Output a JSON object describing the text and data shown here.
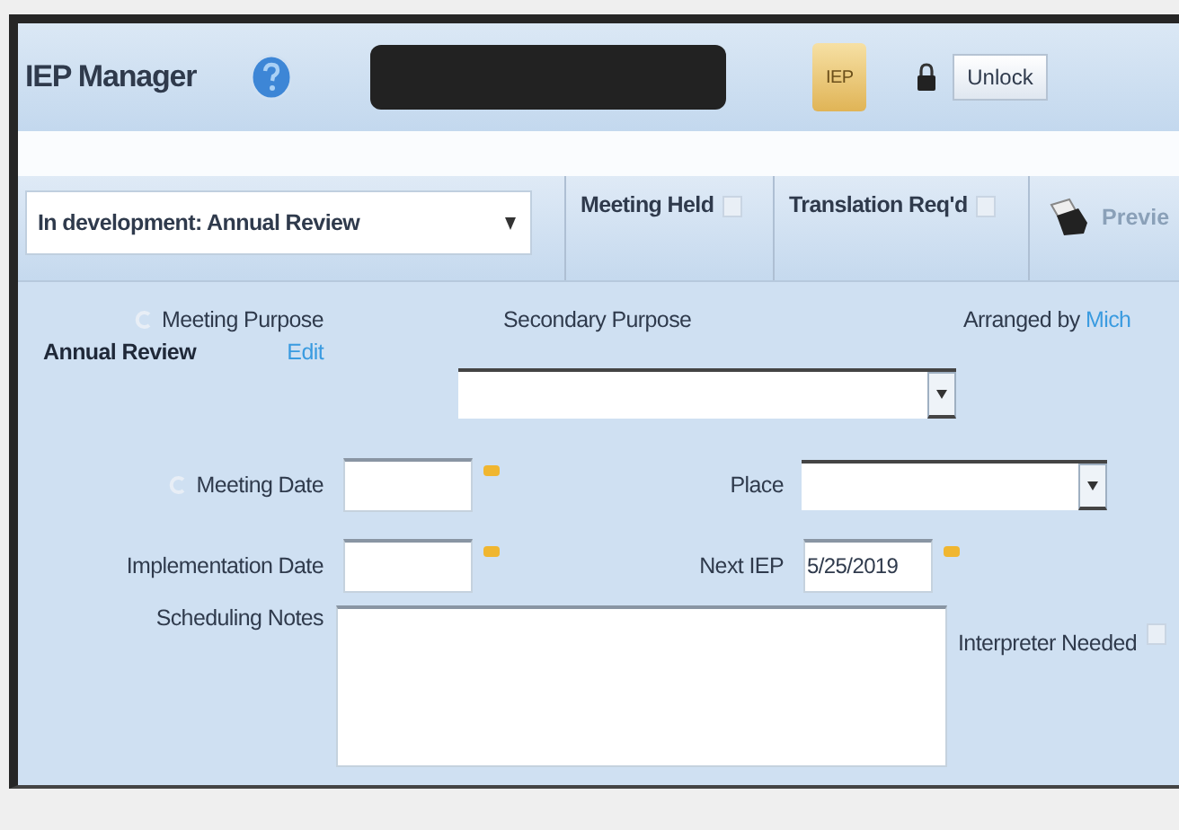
{
  "header": {
    "title": "IEP Manager",
    "folder_label": "IEP",
    "unlock_button": "Unlock"
  },
  "toolbar": {
    "status_select": "In development: Annual Review",
    "checkboxes": [
      {
        "label": "Meeting Held",
        "checked": false
      },
      {
        "label": "Translation Req'd",
        "checked": false
      }
    ],
    "preview_button": "Previe"
  },
  "form": {
    "meeting_purpose": {
      "label": "Meeting Purpose",
      "value": "Annual Review",
      "edit_link": "Edit"
    },
    "secondary_purpose": {
      "label": "Secondary Purpose"
    },
    "arranged_by": {
      "label": "Arranged by",
      "link": "Mich"
    },
    "meeting_date": {
      "label": "Meeting Date"
    },
    "place": {
      "label": "Place"
    },
    "implementation_date": {
      "label": "Implementation Date"
    },
    "next_iep": {
      "label": "Next IEP",
      "value": "5/25/2019"
    },
    "scheduling_notes": {
      "label": "Scheduling Notes"
    },
    "interpreter_needed": {
      "label": "Interpreter Needed",
      "checked": false
    }
  }
}
